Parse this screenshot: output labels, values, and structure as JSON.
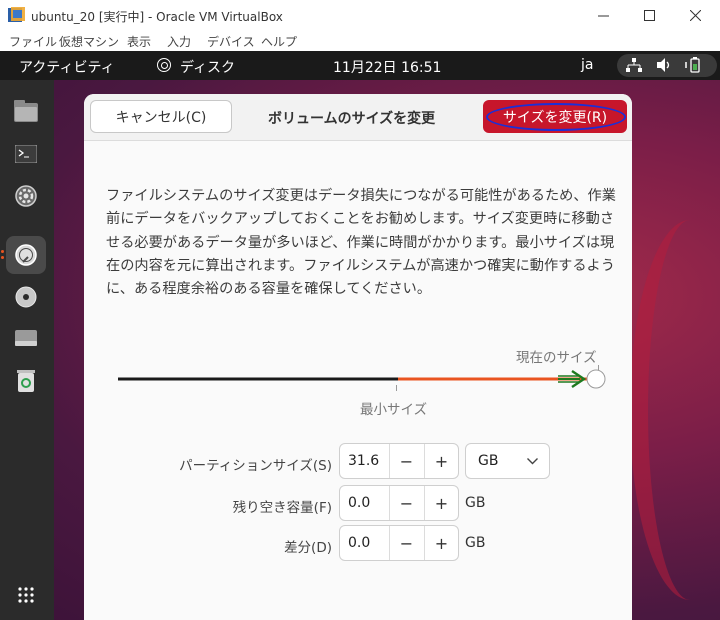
{
  "host_window": {
    "title": "ubuntu_20 [実行中] - Oracle VM VirtualBox",
    "menu": [
      "ファイル",
      "仮想マシン",
      "表示",
      "入力",
      "デバイス",
      "ヘルプ"
    ]
  },
  "ubuntu_topbar": {
    "activities": "アクティビティ",
    "app_name": "ディスク",
    "clock": "11月22日  16:51",
    "input_method": "ja"
  },
  "dock": {
    "items": [
      "files-icon",
      "terminal-icon",
      "settings-icon",
      "disks-icon",
      "optical-disc-icon",
      "drive-icon",
      "trash-icon",
      "app-grid-icon"
    ]
  },
  "dialog": {
    "cancel_label": "キャンセル(C)",
    "title": "ボリュームのサイズを変更",
    "resize_label": "サイズを変更(R)",
    "warning": "ファイルシステムのサイズ変更はデータ損失につながる可能性があるため、作業前にデータをバックアップしておくことをお勧めします。サイズ変更時に移動させる必要があるデータ量が多いほど、作業に時間がかかります。最小サイズは現在の内容を元に算出されます。ファイルシステムが高速かつ確実に動作するように、ある程度余裕のある容量を確保してください。",
    "slider": {
      "current_label": "現在のサイズ",
      "minimum_label": "最小サイズ",
      "min_fraction": 0.58,
      "value_fraction": 1.0
    },
    "partition_size": {
      "label": "パーティションサイズ(S)",
      "value": "31.6",
      "unit": "GB",
      "minus": "−",
      "plus": "+"
    },
    "free_space": {
      "label": "残り空き容量(F)",
      "value": "0.0",
      "unit": "GB",
      "minus": "−",
      "plus": "+"
    },
    "difference": {
      "label": "差分(D)",
      "value": "0.0",
      "unit": "GB",
      "minus": "−",
      "plus": "+"
    }
  },
  "colors": {
    "accent": "#c7162b",
    "slider_used": "#e95420",
    "annotation_arrow": "#1f7a1f",
    "annotation_ellipse": "#1a2fd8"
  }
}
